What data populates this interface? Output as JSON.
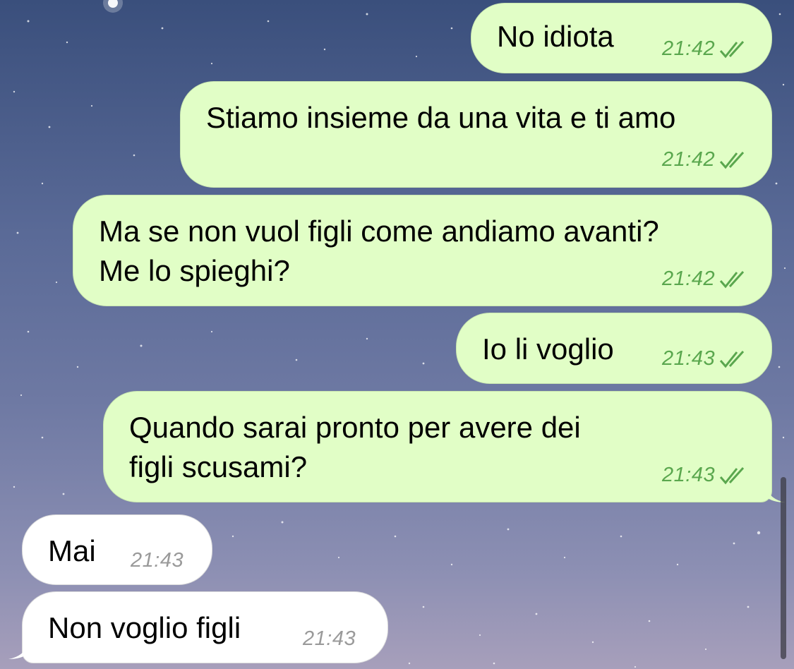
{
  "chat": {
    "messages": [
      {
        "direction": "outgoing",
        "lines": [
          "No idiota"
        ],
        "time": "21:42",
        "status": "read"
      },
      {
        "direction": "outgoing",
        "lines": [
          "Stiamo insieme da una vita e ti amo"
        ],
        "time": "21:42",
        "status": "read"
      },
      {
        "direction": "outgoing",
        "lines": [
          "Ma se non vuol figli come andiamo avanti?",
          "Me lo spieghi?"
        ],
        "time": "21:42",
        "status": "read"
      },
      {
        "direction": "outgoing",
        "lines": [
          "Io li voglio"
        ],
        "time": "21:43",
        "status": "read"
      },
      {
        "direction": "outgoing",
        "lines": [
          "Quando sarai pronto per avere dei",
          "figli scusami?"
        ],
        "time": "21:43",
        "status": "read"
      },
      {
        "direction": "incoming",
        "lines": [
          "Mai"
        ],
        "time": "21:43"
      },
      {
        "direction": "incoming",
        "lines": [
          "Non voglio figli"
        ],
        "time": "21:43"
      }
    ]
  },
  "colors": {
    "outgoing_bubble": "#e1fec6",
    "incoming_bubble": "#ffffff",
    "outgoing_meta": "#5aa74e",
    "incoming_meta": "#9a9a9a"
  },
  "icons": {
    "read_status": "double-check-icon"
  }
}
